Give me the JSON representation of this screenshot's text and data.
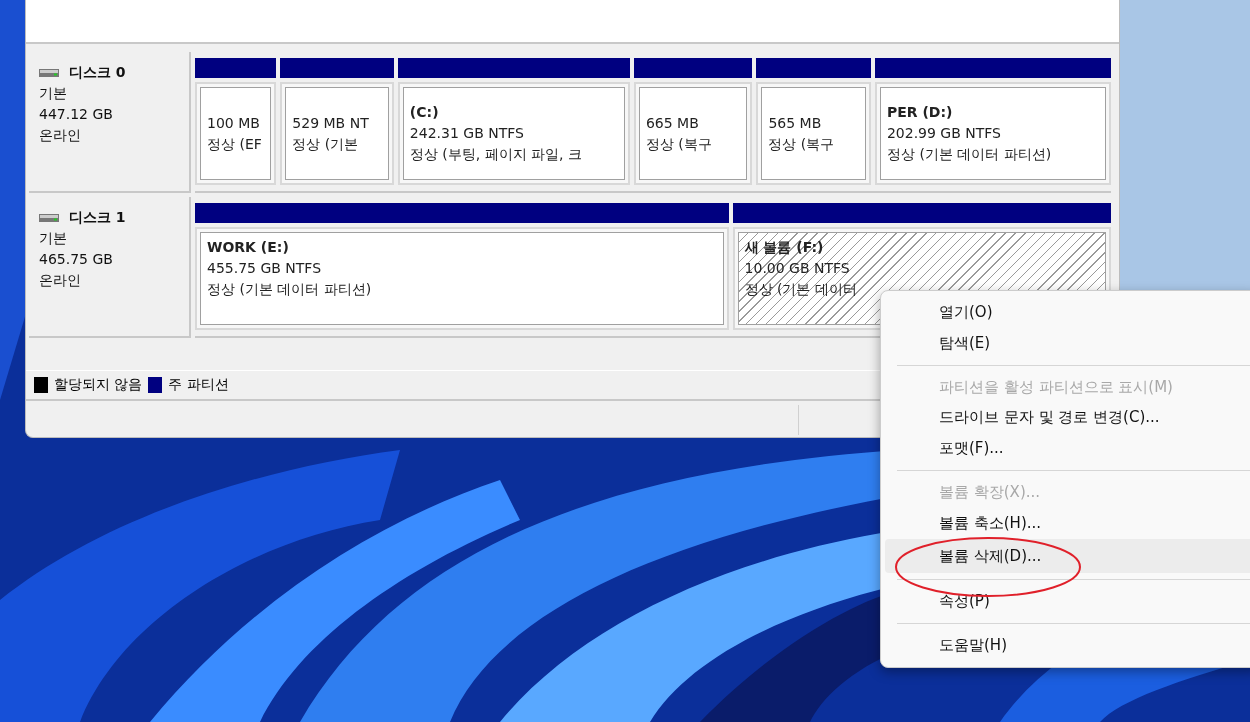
{
  "disks": [
    {
      "name": "디스크 0",
      "type": "기본",
      "size": "447.12 GB",
      "status": "온라인",
      "partitions": [
        {
          "size": "100 MB",
          "status": "정상 (EF",
          "selected": false
        },
        {
          "size": "529 MB NT",
          "status": "정상 (기본",
          "selected": false
        },
        {
          "title": "(C:)",
          "size": "242.31 GB NTFS",
          "status": "정상 (부팅, 페이지 파일, 크",
          "selected": false
        },
        {
          "size": "665 MB",
          "status": "정상 (복구",
          "selected": false
        },
        {
          "size": "565 MB",
          "status": "정상 (복구",
          "selected": false
        },
        {
          "title": "PER  (D:)",
          "size": "202.99 GB NTFS",
          "status": "정상 (기본 데이터 파티션)",
          "selected": false
        }
      ]
    },
    {
      "name": "디스크 1",
      "type": "기본",
      "size": "465.75 GB",
      "status": "온라인",
      "partitions": [
        {
          "title": "WORK  (E:)",
          "size": "455.75 GB NTFS",
          "status": "정상 (기본 데이터 파티션)",
          "selected": false
        },
        {
          "title": "새 볼륨  (F:)",
          "size": "10.00 GB NTFS",
          "status": "정상 (기본 데이터",
          "selected": true
        }
      ]
    }
  ],
  "legend": [
    {
      "label": "할당되지 않음",
      "color": "#000000"
    },
    {
      "label": "주 파티션",
      "color": "#000080"
    }
  ],
  "context_menu": [
    {
      "kind": "item",
      "label": "열기(O)",
      "disabled": false,
      "selected": false
    },
    {
      "kind": "item",
      "label": "탐색(E)",
      "disabled": false,
      "selected": false
    },
    {
      "kind": "separator"
    },
    {
      "kind": "item",
      "label": "파티션을 활성 파티션으로 표시(M)",
      "disabled": true,
      "selected": false
    },
    {
      "kind": "item",
      "label": "드라이브 문자 및 경로 변경(C)...",
      "disabled": false,
      "selected": false
    },
    {
      "kind": "item",
      "label": "포맷(F)...",
      "disabled": false,
      "selected": false
    },
    {
      "kind": "separator"
    },
    {
      "kind": "item",
      "label": "볼륨 확장(X)...",
      "disabled": true,
      "selected": false
    },
    {
      "kind": "item",
      "label": "볼륨 축소(H)...",
      "disabled": false,
      "selected": false
    },
    {
      "kind": "item",
      "label": "볼륨 삭제(D)...",
      "disabled": false,
      "selected": true
    },
    {
      "kind": "separator"
    },
    {
      "kind": "item",
      "label": "속성(P)",
      "disabled": false,
      "selected": false
    },
    {
      "kind": "separator"
    },
    {
      "kind": "item",
      "label": "도움말(H)",
      "disabled": false,
      "selected": false
    }
  ]
}
